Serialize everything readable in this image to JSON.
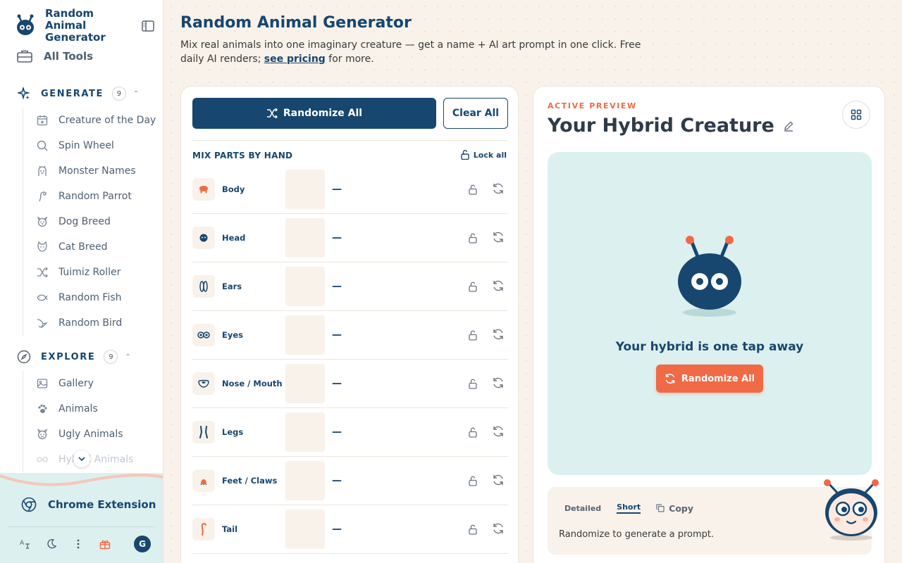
{
  "brand": {
    "name": "Random Animal Generator"
  },
  "sidebar": {
    "all_tools": "All Tools",
    "generate": {
      "label": "GENERATE",
      "count": "9",
      "items": [
        {
          "label": "Creature of the Day",
          "icon": "calendar-icon"
        },
        {
          "label": "Spin Wheel",
          "icon": "search-icon"
        },
        {
          "label": "Monster Names",
          "icon": "monster-icon"
        },
        {
          "label": "Random Parrot",
          "icon": "parrot-icon"
        },
        {
          "label": "Dog Breed",
          "icon": "dog-icon"
        },
        {
          "label": "Cat Breed",
          "icon": "cat-icon"
        },
        {
          "label": "Tuimiz Roller",
          "icon": "shuffle-icon"
        },
        {
          "label": "Random Fish",
          "icon": "fish-icon"
        },
        {
          "label": "Random Bird",
          "icon": "bird-icon"
        }
      ]
    },
    "explore": {
      "label": "EXPLORE",
      "count": "9",
      "items": [
        {
          "label": "Gallery",
          "icon": "image-icon"
        },
        {
          "label": "Animals",
          "icon": "paw-icon"
        },
        {
          "label": "Ugly Animals",
          "icon": "ugly-icon"
        },
        {
          "label": "Hybrid Animals",
          "icon": "hybrid-icon"
        }
      ]
    },
    "extension": "Chrome Extension",
    "avatar_initial": "G"
  },
  "header": {
    "title": "Random Animal Generator",
    "desc_before": "Mix real animals into one imaginary creature — get a name + AI art prompt in one click. Free daily AI renders; ",
    "desc_link": "see pricing",
    "desc_after": " for more."
  },
  "builder": {
    "randomize_label": "Randomize All",
    "clear_label": "Clear All",
    "mix_label": "MIX PARTS BY HAND",
    "lock_all_label": "Lock all",
    "parts": [
      {
        "name": "Body",
        "value": "—",
        "icon": "body-icon"
      },
      {
        "name": "Head",
        "value": "—",
        "icon": "head-icon"
      },
      {
        "name": "Ears",
        "value": "—",
        "icon": "ears-icon"
      },
      {
        "name": "Eyes",
        "value": "—",
        "icon": "eyes-icon"
      },
      {
        "name": "Nose / Mouth",
        "value": "—",
        "icon": "nose-icon"
      },
      {
        "name": "Legs",
        "value": "—",
        "icon": "legs-icon"
      },
      {
        "name": "Feet / Claws",
        "value": "—",
        "icon": "feet-icon"
      },
      {
        "name": "Tail",
        "value": "—",
        "icon": "tail-icon"
      }
    ]
  },
  "preview": {
    "eyebrow": "ACTIVE PREVIEW",
    "title": "Your Hybrid Creature",
    "message": "Your hybrid is one tap away",
    "button_label": "Randomize All",
    "tabs": [
      "Detailed",
      "Short"
    ],
    "active_tab": "Short",
    "copy_label": "Copy",
    "prompt_text": "Randomize to generate a prompt."
  },
  "colors": {
    "navy": "#17466f",
    "accent_orange": "#f06a45",
    "preview_bg": "#dcf0ef",
    "page_bg": "#f8f2ea"
  }
}
